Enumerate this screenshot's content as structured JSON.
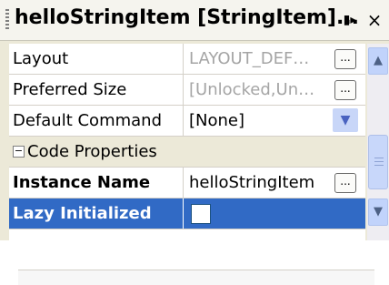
{
  "window": {
    "title": "helloStringItem [StringItem]...",
    "pin_glyph": "▮▸",
    "close_glyph": "×"
  },
  "properties": [
    {
      "name": "Layout",
      "value": "LAYOUT_DEF…",
      "value_style": "disabled",
      "editor": "ellipsis-button"
    },
    {
      "name": "Preferred Size",
      "value": "[Unlocked,Un…",
      "value_style": "disabled",
      "editor": "ellipsis-button"
    },
    {
      "name": "Default Command",
      "value": "[None]",
      "value_style": "normal",
      "editor": "dropdown"
    }
  ],
  "category": {
    "label": "Code Properties",
    "toggle_glyph": "−"
  },
  "code_properties": [
    {
      "name": "Instance Name",
      "value": "helloStringItem",
      "editor": "ellipsis-button",
      "bold": true
    },
    {
      "name": "Lazy Initialized",
      "checked": false,
      "editor": "checkbox",
      "bold": true,
      "selected": true
    }
  ],
  "ellipsis_label": "...",
  "icons": {
    "dropdown": "chevron-down-icon",
    "scroll_up": "chevron-up-icon",
    "scroll_down": "chevron-down-icon"
  },
  "colors": {
    "selection": "#316ac5",
    "disabled_text": "#a5a5a5",
    "panel_bg": "#ece9d8"
  }
}
